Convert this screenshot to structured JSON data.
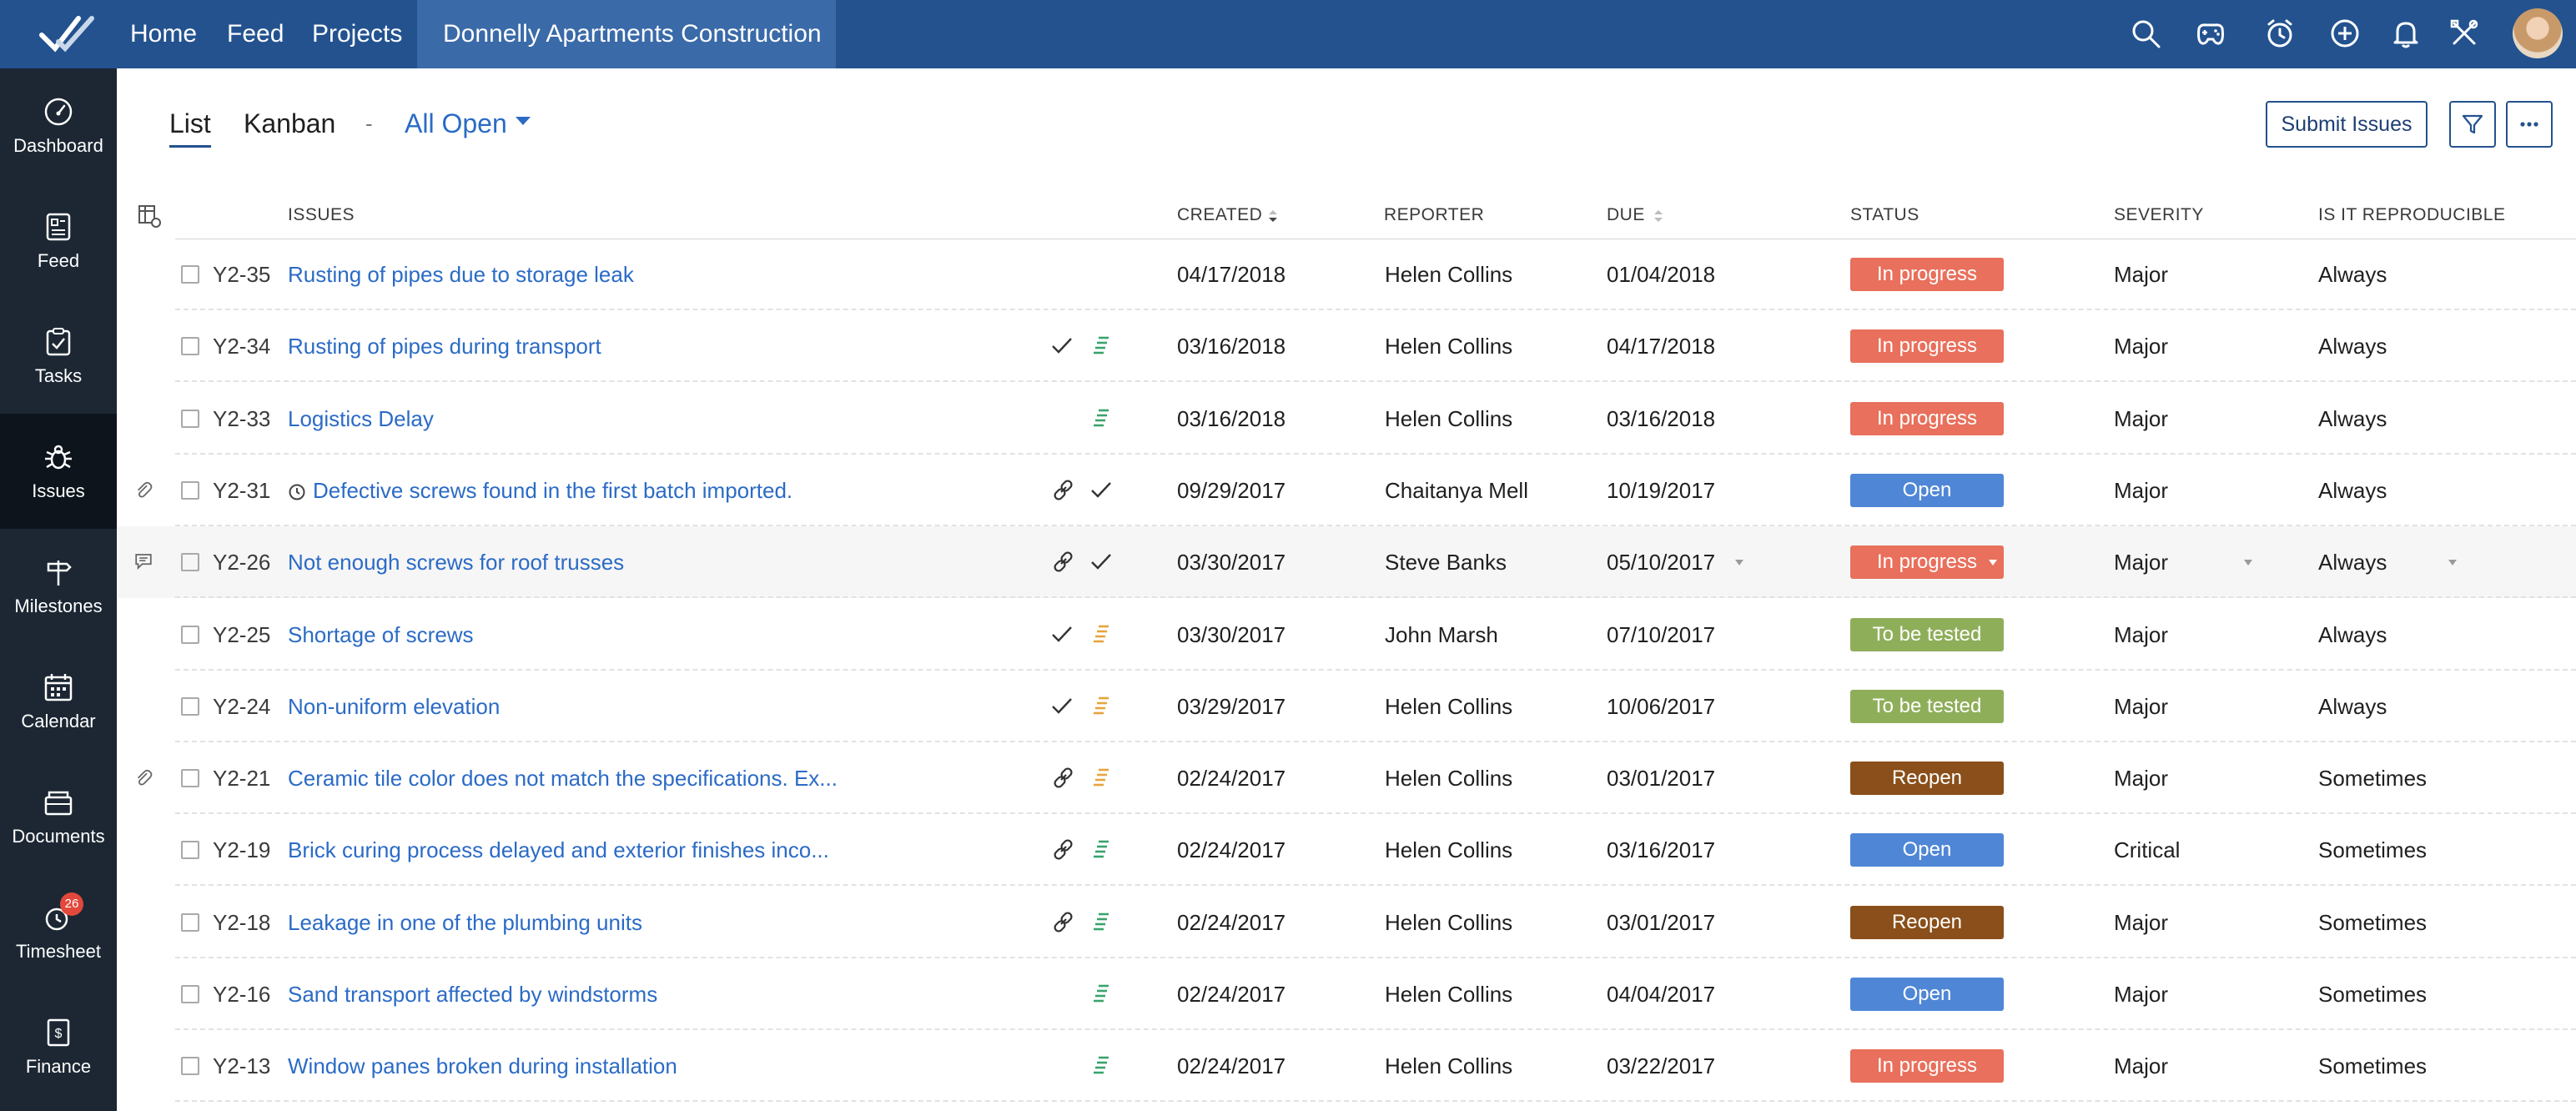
{
  "nav": {
    "links": [
      "Home",
      "Feed",
      "Projects"
    ],
    "project": "Donnelly Apartments Construction",
    "icons": [
      "search-icon",
      "gamepad-icon",
      "timer-icon",
      "add-icon",
      "bell-icon",
      "tools-icon"
    ]
  },
  "sidebar": {
    "items": [
      {
        "label": "Dashboard",
        "icon": "dashboard-icon"
      },
      {
        "label": "Feed",
        "icon": "feed-icon"
      },
      {
        "label": "Tasks",
        "icon": "tasks-icon"
      },
      {
        "label": "Issues",
        "icon": "bug-icon"
      },
      {
        "label": "Milestones",
        "icon": "milestone-icon"
      },
      {
        "label": "Calendar",
        "icon": "calendar-icon"
      },
      {
        "label": "Documents",
        "icon": "documents-icon"
      },
      {
        "label": "Timesheet",
        "icon": "timesheet-icon",
        "badge": "26"
      },
      {
        "label": "Finance",
        "icon": "finance-icon"
      }
    ]
  },
  "toolbar": {
    "tab_list": "List",
    "tab_kanban": "Kanban",
    "separator": "-",
    "view": "All Open",
    "submit": "Submit Issues"
  },
  "table": {
    "headers": {
      "issues": "ISSUES",
      "created": "CREATED",
      "reporter": "REPORTER",
      "due": "DUE",
      "status": "STATUS",
      "severity": "SEVERITY",
      "reproducible": "IS IT REPRODUCIBLE"
    },
    "rows": [
      {
        "key": "Y2-35",
        "title": "Rusting of pipes due to storage leak",
        "created": "04/17/2018",
        "reporter": "Helen Collins",
        "due": "01/04/2018",
        "status": "In progress",
        "severity": "Major",
        "reproducible": "Always"
      },
      {
        "key": "Y2-34",
        "title": "Rusting of pipes during transport",
        "created": "03/16/2018",
        "reporter": "Helen Collins",
        "due": "04/17/2018",
        "status": "In progress",
        "severity": "Major",
        "reproducible": "Always"
      },
      {
        "key": "Y2-33",
        "title": "Logistics Delay",
        "created": "03/16/2018",
        "reporter": "Helen Collins",
        "due": "03/16/2018",
        "status": "In progress",
        "severity": "Major",
        "reproducible": "Always"
      },
      {
        "key": "Y2-31",
        "title": "Defective screws found in the first batch imported.",
        "created": "09/29/2017",
        "reporter": "Chaitanya Mell",
        "due": "10/19/2017",
        "status": "Open",
        "severity": "Major",
        "reproducible": "Always"
      },
      {
        "key": "Y2-26",
        "title": "Not enough screws for roof trusses",
        "created": "03/30/2017",
        "reporter": "Steve Banks",
        "due": "05/10/2017",
        "status": "In progress",
        "severity": "Major",
        "reproducible": "Always"
      },
      {
        "key": "Y2-25",
        "title": "Shortage of screws",
        "created": "03/30/2017",
        "reporter": "John Marsh",
        "due": "07/10/2017",
        "status": "To be tested",
        "severity": "Major",
        "reproducible": "Always"
      },
      {
        "key": "Y2-24",
        "title": "Non-uniform elevation",
        "created": "03/29/2017",
        "reporter": "Helen Collins",
        "due": "10/06/2017",
        "status": "To be tested",
        "severity": "Major",
        "reproducible": "Always"
      },
      {
        "key": "Y2-21",
        "title": "Ceramic tile color does not match the specifications. Ex...",
        "created": "02/24/2017",
        "reporter": "Helen Collins",
        "due": "03/01/2017",
        "status": "Reopen",
        "severity": "Major",
        "reproducible": "Sometimes"
      },
      {
        "key": "Y2-19",
        "title": "Brick curing process delayed and exterior finishes inco...",
        "created": "02/24/2017",
        "reporter": "Helen Collins",
        "due": "03/16/2017",
        "status": "Open",
        "severity": "Critical",
        "reproducible": "Sometimes"
      },
      {
        "key": "Y2-18",
        "title": "Leakage in one of the plumbing units",
        "created": "02/24/2017",
        "reporter": "Helen Collins",
        "due": "03/01/2017",
        "status": "Reopen",
        "severity": "Major",
        "reproducible": "Sometimes"
      },
      {
        "key": "Y2-16",
        "title": "Sand transport affected by windstorms",
        "created": "02/24/2017",
        "reporter": "Helen Collins",
        "due": "04/04/2017",
        "status": "Open",
        "severity": "Major",
        "reproducible": "Sometimes"
      },
      {
        "key": "Y2-13",
        "title": "Window panes broken during installation",
        "created": "02/24/2017",
        "reporter": "Helen Collins",
        "due": "03/22/2017",
        "status": "In progress",
        "severity": "Major",
        "reproducible": "Sometimes"
      }
    ]
  },
  "status_colors": {
    "In progress": "#e8705c",
    "Open": "#4f87d6",
    "To be tested": "#8fae5a",
    "Reopen": "#8a4f1a"
  }
}
